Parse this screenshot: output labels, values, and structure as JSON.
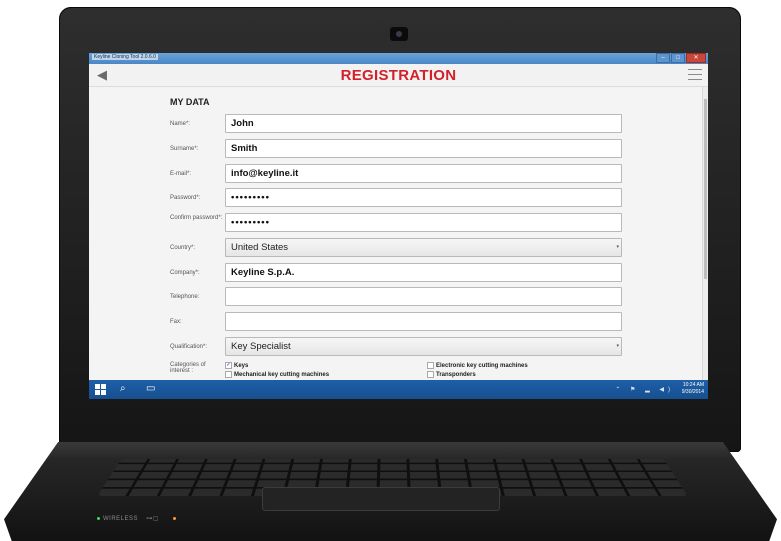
{
  "window": {
    "app_title": "Keyline Cloning Tool 2.0.6.0",
    "minimize": "–",
    "maximize": "□",
    "close": "✕"
  },
  "header": {
    "title": "REGISTRATION",
    "back_icon": "chevron-left-icon",
    "menu_icon": "hamburger-icon"
  },
  "form": {
    "section_title": "MY DATA",
    "fields": [
      {
        "label": "Name*:",
        "value": "John"
      },
      {
        "label": "Surname*:",
        "value": "Smith"
      },
      {
        "label": "E-mail*:",
        "value": "info@keyline.it"
      },
      {
        "label": "Password*:",
        "value": "•••••••••"
      },
      {
        "label": "Confirm password*:",
        "value": "•••••••••"
      },
      {
        "label": "Country*:",
        "value": "United States"
      },
      {
        "label": "Company*:",
        "value": "Keyline S.p.A."
      },
      {
        "label": "Telephone:",
        "value": ""
      },
      {
        "label": "Fax:",
        "value": ""
      },
      {
        "label": "Qualification*:",
        "value": "Key Specialist"
      }
    ],
    "categories": {
      "label": "Categories of interest :",
      "options": [
        {
          "label": "Keys",
          "checked": true
        },
        {
          "label": "Electronic key cutting machines",
          "checked": false
        },
        {
          "label": "Mechanical key cutting machines",
          "checked": false
        },
        {
          "label": "Transponders",
          "checked": false
        }
      ]
    }
  },
  "taskbar": {
    "time": "10:24 AM",
    "date": "9/30/2014",
    "search_icon": "⌕",
    "explorer_icon": "▭",
    "tray_icons": "⌃ ⚑ ▂ ◀)"
  },
  "hardware": {
    "wireless_label": "WIRELESS",
    "indicator_icons": "⊶▢"
  },
  "colors": {
    "title_red": "#d3212b",
    "taskbar_blue": "#1e5fa8"
  }
}
